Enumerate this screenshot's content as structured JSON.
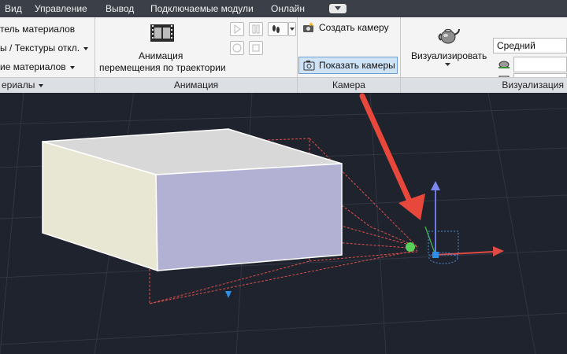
{
  "menu": {
    "items": [
      "Вид",
      "Управление",
      "Вывод",
      "Подключаемые модули",
      "Онлайн"
    ],
    "cloud_icon": "cloud-dropdown-icon"
  },
  "materials_panel": {
    "line1": "тель материалов",
    "line2": "ы / Текстуры откл.",
    "line3": "ие материалов",
    "footer": "ериалы"
  },
  "animation_panel": {
    "button_line1": "Анимация",
    "button_line2": "перемещения по траектории",
    "footer": "Анимация"
  },
  "camera_panel": {
    "create_label": "Создать камеру",
    "show_label": "Показать камеры",
    "footer": "Камера"
  },
  "render_panel": {
    "button_label": "Визуализировать",
    "quality_value": "Средний",
    "footer": "Визуализация"
  },
  "colors": {
    "menubar": "#3b3f47",
    "ribbon": "#f4f4f4",
    "viewport": "#1f232d",
    "arrow": "#e8473c",
    "box_front": "#b3b1d3",
    "box_side": "#e8e7d3",
    "box_top": "#d8d8d8"
  }
}
